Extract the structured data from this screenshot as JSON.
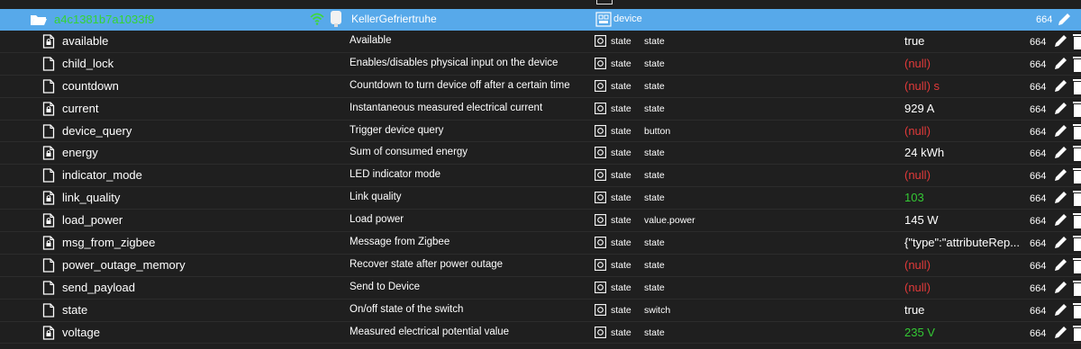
{
  "header": {
    "id": "a4c1381b7a1033f9",
    "name": "KellerGefriertruhe",
    "type": "device",
    "value": "664"
  },
  "rows": [
    {
      "id": "available",
      "name": "Available",
      "type": "state",
      "role": "state",
      "value": "true",
      "value_style": "normal",
      "num": "664",
      "icon": "file-lock"
    },
    {
      "id": "child_lock",
      "name": "Enables/disables physical input on the device",
      "type": "state",
      "role": "state",
      "value": "(null)",
      "value_style": "null",
      "num": "664",
      "icon": "file"
    },
    {
      "id": "countdown",
      "name": "Countdown to turn device off after a certain time",
      "type": "state",
      "role": "state",
      "value": "(null) s",
      "value_style": "null",
      "num": "664",
      "icon": "file"
    },
    {
      "id": "current",
      "name": "Instantaneous measured electrical current",
      "type": "state",
      "role": "state",
      "value": "929 A",
      "value_style": "normal",
      "num": "664",
      "icon": "file-lock"
    },
    {
      "id": "device_query",
      "name": "Trigger device query",
      "type": "state",
      "role": "button",
      "value": "(null)",
      "value_style": "null",
      "num": "664",
      "icon": "file"
    },
    {
      "id": "energy",
      "name": "Sum of consumed energy",
      "type": "state",
      "role": "state",
      "value": "24 kWh",
      "value_style": "normal",
      "num": "664",
      "icon": "file-lock"
    },
    {
      "id": "indicator_mode",
      "name": "LED indicator mode",
      "type": "state",
      "role": "state",
      "value": "(null)",
      "value_style": "null",
      "num": "664",
      "icon": "file"
    },
    {
      "id": "link_quality",
      "name": "Link quality",
      "type": "state",
      "role": "state",
      "value": "103",
      "value_style": "green",
      "num": "664",
      "icon": "file-lock"
    },
    {
      "id": "load_power",
      "name": "Load power",
      "type": "state",
      "role": "value.power",
      "value": "145 W",
      "value_style": "normal",
      "num": "664",
      "icon": "file-lock"
    },
    {
      "id": "msg_from_zigbee",
      "name": "Message from Zigbee",
      "type": "state",
      "role": "state",
      "value": "{\"type\":\"attributeRep...",
      "value_style": "normal",
      "num": "664",
      "icon": "file-lock"
    },
    {
      "id": "power_outage_memory",
      "name": "Recover state after power outage",
      "type": "state",
      "role": "state",
      "value": "(null)",
      "value_style": "null",
      "num": "664",
      "icon": "file"
    },
    {
      "id": "send_payload",
      "name": "Send to Device",
      "type": "state",
      "role": "state",
      "value": "(null)",
      "value_style": "null",
      "num": "664",
      "icon": "file"
    },
    {
      "id": "state",
      "name": "On/off state of the switch",
      "type": "state",
      "role": "switch",
      "value": "true",
      "value_style": "normal",
      "num": "664",
      "icon": "file"
    },
    {
      "id": "voltage",
      "name": "Measured electrical potential value",
      "type": "state",
      "role": "state",
      "value": "235 V",
      "value_style": "green",
      "num": "664",
      "icon": "file-lock"
    }
  ]
}
